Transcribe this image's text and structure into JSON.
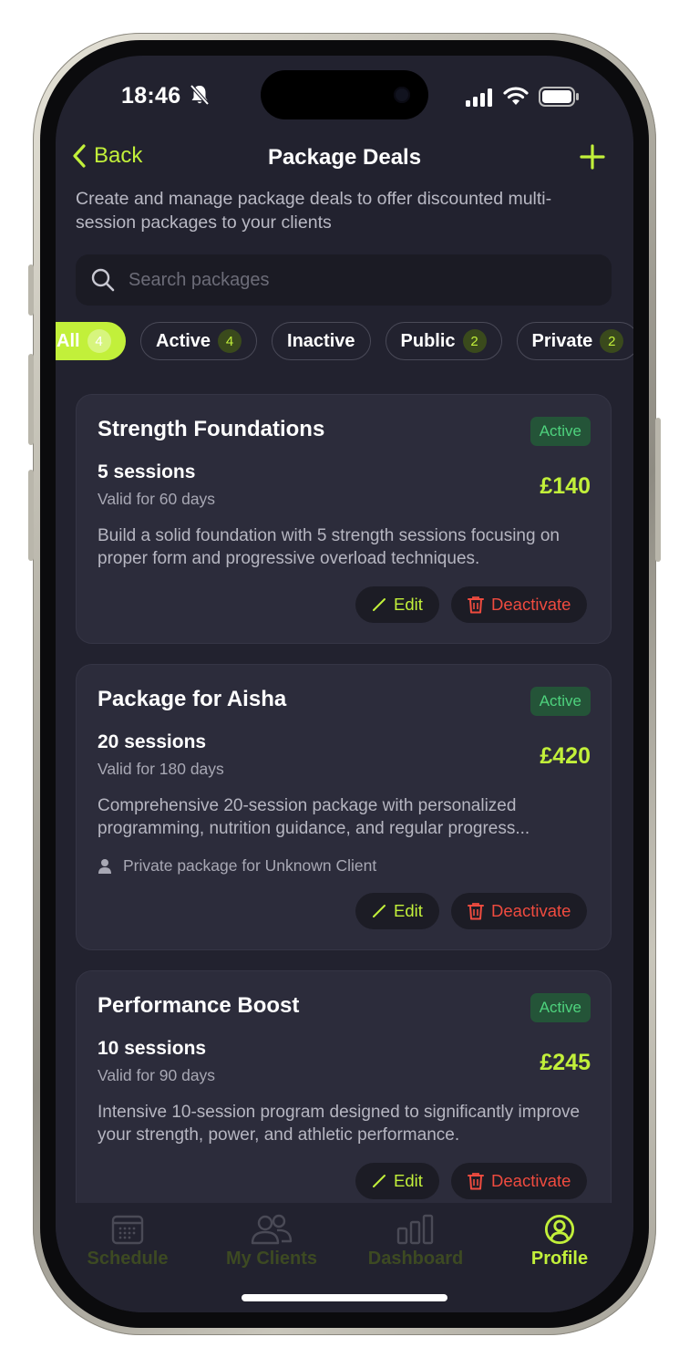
{
  "status_bar": {
    "time": "18:46"
  },
  "header": {
    "back_label": "Back",
    "title": "Package Deals",
    "subtitle": "Create and manage package deals to offer discounted multi-session packages to your clients"
  },
  "search": {
    "placeholder": "Search packages",
    "value": ""
  },
  "filters": [
    {
      "label": "All",
      "count": "4",
      "selected": true
    },
    {
      "label": "Active",
      "count": "4"
    },
    {
      "label": "Inactive",
      "count": ""
    },
    {
      "label": "Public",
      "count": "2"
    },
    {
      "label": "Private",
      "count": "2"
    }
  ],
  "packages": [
    {
      "title": "Strength Foundations",
      "status": "Active",
      "sessions": "5 sessions",
      "validity": "Valid for 60 days",
      "price": "£140",
      "description": "Build a solid foundation with 5 strength sessions focusing on proper form and progressive overload techniques.",
      "edit_label": "Edit",
      "deactivate_label": "Deactivate"
    },
    {
      "title": "Package for Aisha",
      "status": "Active",
      "sessions": "20 sessions",
      "validity": "Valid for 180 days",
      "price": "£420",
      "description_line1": "Comprehensive 20-session package with personalized",
      "description_line2": "programming, nutrition guidance, and regular progress...",
      "private_note": "Private package for Unknown Client",
      "edit_label": "Edit",
      "deactivate_label": "Deactivate"
    },
    {
      "title": "Performance Boost",
      "status": "Active",
      "sessions": "10 sessions",
      "validity": "Valid for 90 days",
      "price": "£245",
      "description": "Intensive 10-session program designed to significantly improve your strength, power, and athletic performance.",
      "edit_label": "Edit",
      "deactivate_label": "Deactivate"
    }
  ],
  "tabbar": [
    {
      "label": "Schedule",
      "icon": "calendar-icon"
    },
    {
      "label": "My Clients",
      "icon": "users-icon"
    },
    {
      "label": "Dashboard",
      "icon": "bar-chart-icon"
    },
    {
      "label": "Profile",
      "icon": "profile-icon",
      "selected": true
    }
  ],
  "colors": {
    "accent": "#c2f03a",
    "background": "#22222f",
    "card": "#2c2c3b",
    "active_badge": "#4ed27d",
    "danger": "#ef4b3f"
  }
}
